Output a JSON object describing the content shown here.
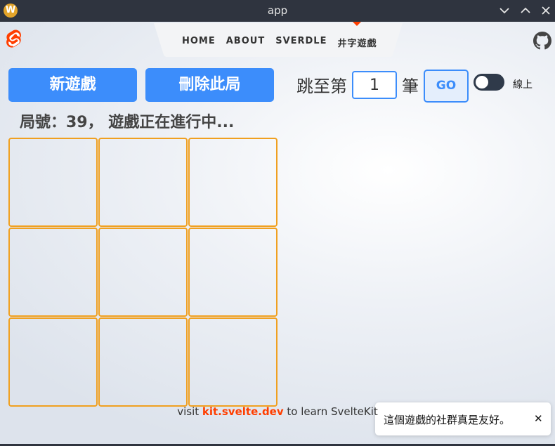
{
  "window": {
    "title": "app",
    "app_icon": "W",
    "controls": [
      "minimize-icon",
      "maximize-icon",
      "close-icon"
    ]
  },
  "header": {
    "logo": "svelte-logo-icon",
    "nav": [
      {
        "label": "HOME",
        "active": false
      },
      {
        "label": "ABOUT",
        "active": false
      },
      {
        "label": "SVERDLE",
        "active": false
      },
      {
        "label": "井字遊戲",
        "active": true
      }
    ],
    "github_icon": "github-icon",
    "accent_color": "#ff3e00"
  },
  "controls": {
    "new_game_label": "新遊戲",
    "delete_game_label": "刪除此局",
    "jump_prefix": "跳至第",
    "jump_value": "1",
    "jump_suffix": "筆",
    "go_label": "GO",
    "online_label": "線上",
    "online_enabled": false,
    "button_color": "#3c8dfb"
  },
  "status": "局號：39， 遊戲正在進行中...",
  "board": {
    "cells": [
      "",
      "",
      "",
      "",
      "",
      "",
      "",
      "",
      ""
    ],
    "border_color": "#f0a020"
  },
  "footer": {
    "prefix": "visit ",
    "link": "kit.svelte.dev",
    "suffix": " to learn SvelteKit"
  },
  "toast": {
    "message": "這個遊戲的社群真是友好。",
    "close_label": "✕"
  }
}
